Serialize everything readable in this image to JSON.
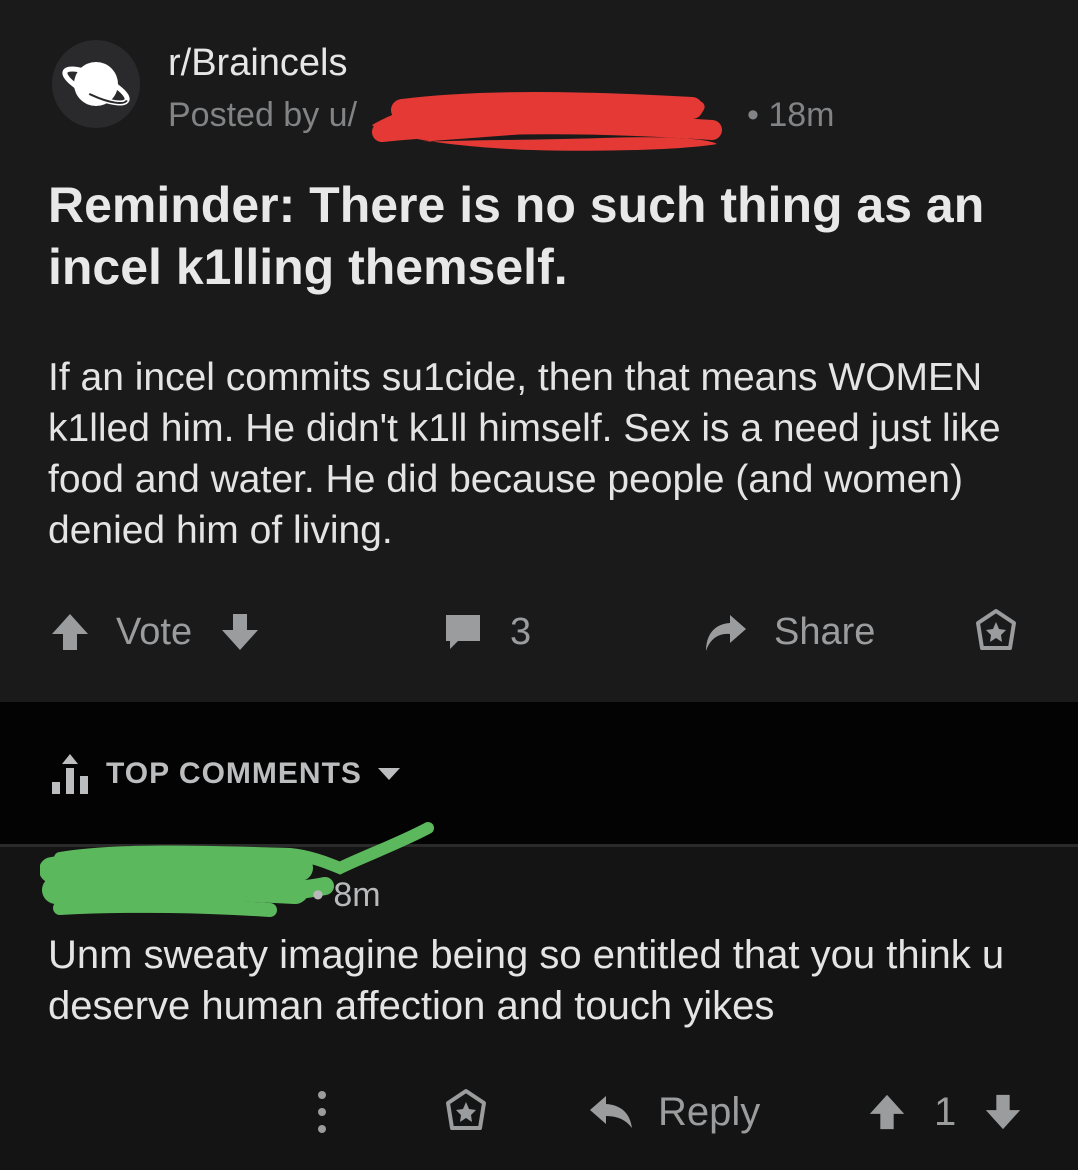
{
  "post": {
    "subreddit": "r/Braincels",
    "posted_by": "Posted by u/",
    "time": "• 18m",
    "title": "Reminder: There is no such thing as an incel k1lling themself.",
    "body": "If an incel commits su1cide, then that means WOMEN k1lled him. He didn't k1ll himself. Sex is a need just like food and water. He did because people (and women) denied him of living.",
    "actions": {
      "vote_label": "Vote",
      "comment_count": "3",
      "share_label": "Share"
    }
  },
  "comments_header": {
    "sort_label": "TOP COMMENTS"
  },
  "comment": {
    "time": "• 8m",
    "text": "Unm sweaty imagine being so entitled that you think u deserve human affection and touch yikes",
    "actions": {
      "reply_label": "Reply",
      "score": "1"
    }
  },
  "colors": {
    "post_bg": "#1a1a1b",
    "band_bg": "#030303",
    "comment_bg": "#141414",
    "redaction_red": "#e53935",
    "redaction_green": "#5cb85c",
    "muted_text": "#818384"
  },
  "icons": [
    "planet-icon",
    "upvote-icon",
    "downvote-icon",
    "comment-icon",
    "share-arrow-icon",
    "award-icon",
    "sort-icon",
    "chevron-down-icon",
    "more-icon",
    "reply-icon"
  ]
}
